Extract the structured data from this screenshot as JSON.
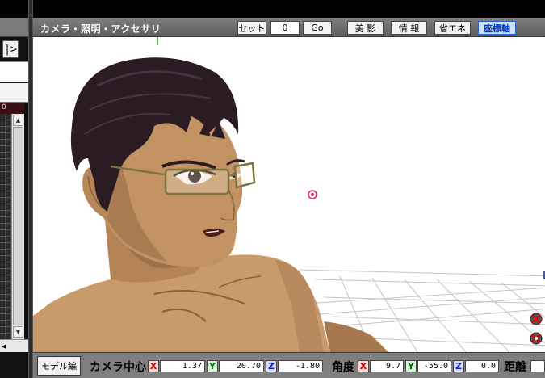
{
  "toolbar": {
    "title": "カメラ・照明・アクセサリ",
    "set_label": "セット",
    "frame_value": "0",
    "go_label": "Go",
    "beauty_label": "美 影",
    "info_label": "情 報",
    "energy_label": "省エネ",
    "axis_label": "座標軸"
  },
  "left_panel": {
    "next_label": "|>",
    "frame_header": "0"
  },
  "bottom": {
    "model_edit_label": "モデル編",
    "camera_center_label": "カメラ中心",
    "angle_label": "角度",
    "distance_label": "距離",
    "axis_x": "X",
    "axis_y": "Y",
    "axis_z": "Z",
    "center_x": "1.37",
    "center_y": "20.70",
    "center_z": "-1.80",
    "angle_x": "9.7",
    "angle_y": "-55.0",
    "angle_z": "0.0"
  },
  "colors": {
    "toolbar_bg": "#6e6e6e",
    "axis_active": "#2a5fd0",
    "axis_x": "#c00000",
    "axis_y": "#007000",
    "axis_z": "#0020b0",
    "camera_target": "#e0206a"
  }
}
